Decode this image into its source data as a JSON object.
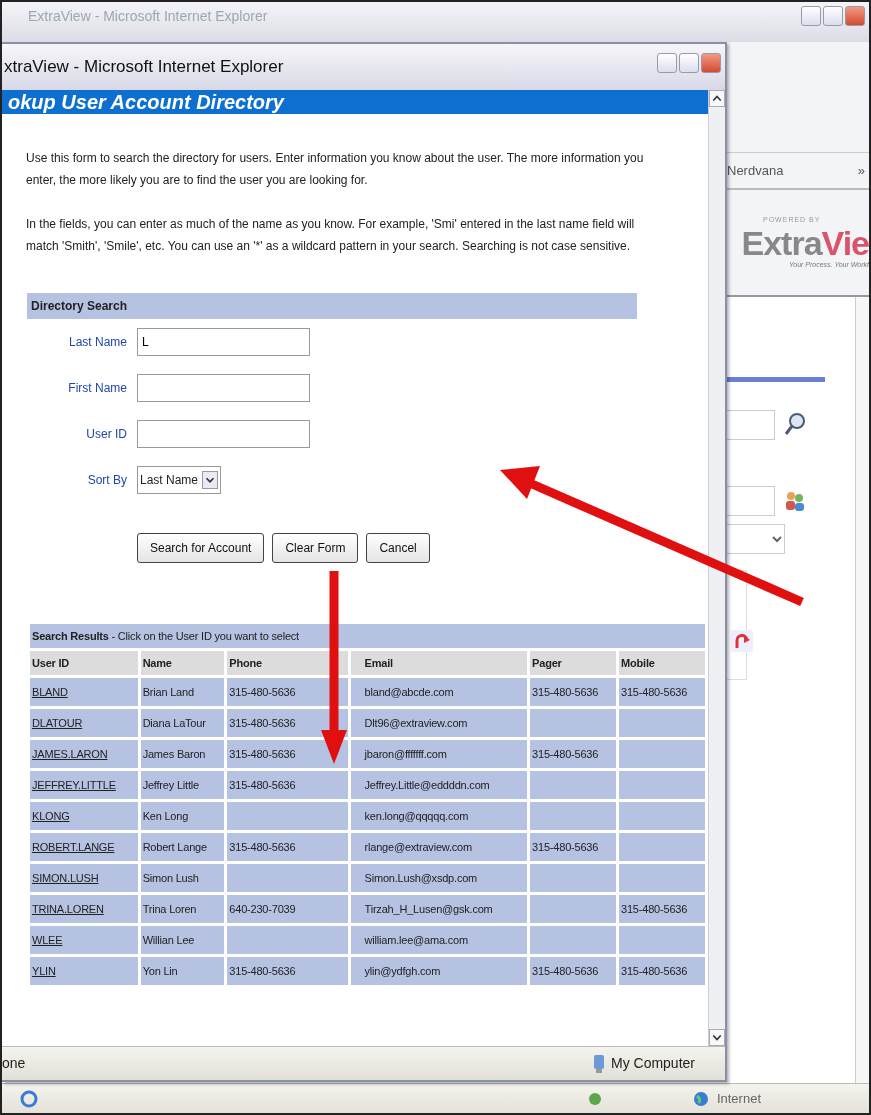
{
  "background_window": {
    "title": "ExtraView - Microsoft Internet Explorer",
    "tab": "Nerdvana",
    "tab_more": "»",
    "logo": {
      "powered_by": "POWERED BY",
      "name_dark": "Extra",
      "name_red": "Vie",
      "tagline": "Your Process. Your Workf"
    },
    "status_bar": {
      "zone": "Internet"
    }
  },
  "popup": {
    "title": "xtraView - Microsoft Internet Explorer",
    "page_heading": "okup User Account Directory",
    "intro": [
      "Use this form to search the directory for users. Enter information you know about the user. The more information you enter, the more likely you are to find the user you are looking for.",
      "In the fields, you can enter as much of the name as you know. For example, 'Smi' entered in the last name field will match 'Smith', 'Smile', etc. You can use an '*' as a wildcard pattern in your search. Searching is not case sensitive."
    ],
    "search_form": {
      "heading": "Directory Search",
      "fields": [
        {
          "kind": "text",
          "label": "Last Name",
          "value": "L"
        },
        {
          "kind": "text",
          "label": "First Name"
        },
        {
          "kind": "text",
          "label": "User ID"
        },
        {
          "kind": "select",
          "label": "Sort By",
          "value": "Last Name"
        }
      ],
      "buttons": [
        "Search for Account",
        "Clear Form",
        "Cancel"
      ]
    },
    "results": {
      "title": "**Search Results** - Click on the User ID you want to select",
      "columns": [
        "User ID",
        "Name",
        "Phone",
        "Email",
        "Pager",
        "Mobile"
      ],
      "rows": [
        [
          "BLAND",
          "Brian Land",
          "315-480-5636",
          "bland@abcde.com",
          "315-480-5636",
          "315-480-5636"
        ],
        [
          "DLATOUR",
          "Diana LaTour",
          "315-480-5636",
          "Dlt96@extraview.com",
          null,
          null
        ],
        [
          "JAMES.LARON",
          "James Baron",
          "315-480-5636",
          "jbaron@fffffff.com",
          "315-480-5636",
          null
        ],
        [
          "JEFFREY.LITTLE",
          "Jeffrey Little",
          "315-480-5636",
          "Jeffrey.Little@eddddn.com",
          null,
          null
        ],
        [
          "KLONG",
          "Ken Long",
          null,
          "ken.long@qqqqq.com",
          null,
          null
        ],
        [
          "ROBERT.LANGE",
          "Robert Lange",
          "315-480-5636",
          "rlange@extraview.com",
          "315-480-5636",
          null
        ],
        [
          "SIMON.LUSH",
          "Simon Lush",
          null,
          "Simon.Lush@xsdp.com",
          null,
          null
        ],
        [
          "TRINA.LOREN",
          "Trina Loren",
          "640-230-7039",
          "Tirzah_H_Lusen@gsk.com",
          null,
          "315-480-5636"
        ],
        [
          "WLEE",
          "Willian Lee",
          null,
          "william.lee@ama.com",
          null,
          null
        ],
        [
          "YLIN",
          "Yon Lin",
          "315-480-5636",
          "ylin@ydfgh.com",
          "315-480-5636",
          "315-480-5636"
        ]
      ]
    },
    "status_bar": {
      "text": "one",
      "zone": "My Computer"
    }
  }
}
